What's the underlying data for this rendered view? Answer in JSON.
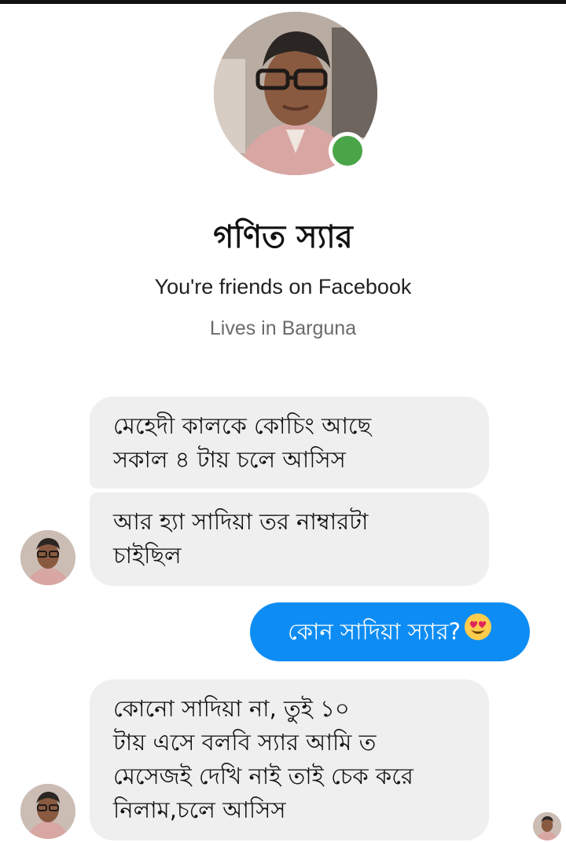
{
  "profile": {
    "name": "গণিত স্যার",
    "friends_text": "You're friends on Facebook",
    "lives_text": "Lives in Barguna",
    "online": true
  },
  "messages": [
    {
      "from": "them",
      "text": "মেহেদী কালকে কোচিং আছে\nসকাল ৪ টায় চলে আসিস"
    },
    {
      "from": "them",
      "text": "আর হ্যা সাদিয়া তর নাম্বারটা\nচাইছিল"
    },
    {
      "from": "me",
      "text": "কোন সাদিয়া স্যার?",
      "emoji": "heart-eyes-emoji"
    },
    {
      "from": "them",
      "text": "কোনো সাদিয়া না, তুই ১০\nটায় এসে বলবি স্যার আমি ত\nমেসেজই দেখি নাই তাই চেক করে\nনিলাম,চলে আসিস"
    }
  ],
  "colors": {
    "sent_bubble": "#0d8df4",
    "received_bubble": "#efefef",
    "online": "#4aa548"
  }
}
